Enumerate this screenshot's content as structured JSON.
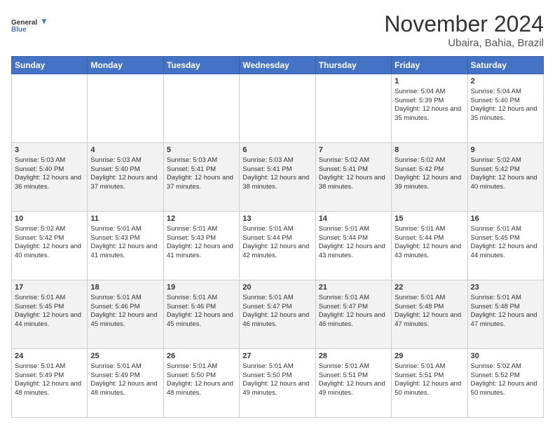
{
  "logo": {
    "line1": "General",
    "line2": "Blue"
  },
  "title": "November 2024",
  "location": "Ubaira, Bahia, Brazil",
  "days_of_week": [
    "Sunday",
    "Monday",
    "Tuesday",
    "Wednesday",
    "Thursday",
    "Friday",
    "Saturday"
  ],
  "weeks": [
    [
      {
        "day": "",
        "sunrise": "",
        "sunset": "",
        "daylight": ""
      },
      {
        "day": "",
        "sunrise": "",
        "sunset": "",
        "daylight": ""
      },
      {
        "day": "",
        "sunrise": "",
        "sunset": "",
        "daylight": ""
      },
      {
        "day": "",
        "sunrise": "",
        "sunset": "",
        "daylight": ""
      },
      {
        "day": "",
        "sunrise": "",
        "sunset": "",
        "daylight": ""
      },
      {
        "day": "1",
        "sunrise": "Sunrise: 5:04 AM",
        "sunset": "Sunset: 5:39 PM",
        "daylight": "Daylight: 12 hours and 35 minutes."
      },
      {
        "day": "2",
        "sunrise": "Sunrise: 5:04 AM",
        "sunset": "Sunset: 5:40 PM",
        "daylight": "Daylight: 12 hours and 35 minutes."
      }
    ],
    [
      {
        "day": "3",
        "sunrise": "Sunrise: 5:03 AM",
        "sunset": "Sunset: 5:40 PM",
        "daylight": "Daylight: 12 hours and 36 minutes."
      },
      {
        "day": "4",
        "sunrise": "Sunrise: 5:03 AM",
        "sunset": "Sunset: 5:40 PM",
        "daylight": "Daylight: 12 hours and 37 minutes."
      },
      {
        "day": "5",
        "sunrise": "Sunrise: 5:03 AM",
        "sunset": "Sunset: 5:41 PM",
        "daylight": "Daylight: 12 hours and 37 minutes."
      },
      {
        "day": "6",
        "sunrise": "Sunrise: 5:03 AM",
        "sunset": "Sunset: 5:41 PM",
        "daylight": "Daylight: 12 hours and 38 minutes."
      },
      {
        "day": "7",
        "sunrise": "Sunrise: 5:02 AM",
        "sunset": "Sunset: 5:41 PM",
        "daylight": "Daylight: 12 hours and 38 minutes."
      },
      {
        "day": "8",
        "sunrise": "Sunrise: 5:02 AM",
        "sunset": "Sunset: 5:42 PM",
        "daylight": "Daylight: 12 hours and 39 minutes."
      },
      {
        "day": "9",
        "sunrise": "Sunrise: 5:02 AM",
        "sunset": "Sunset: 5:42 PM",
        "daylight": "Daylight: 12 hours and 40 minutes."
      }
    ],
    [
      {
        "day": "10",
        "sunrise": "Sunrise: 5:02 AM",
        "sunset": "Sunset: 5:42 PM",
        "daylight": "Daylight: 12 hours and 40 minutes."
      },
      {
        "day": "11",
        "sunrise": "Sunrise: 5:01 AM",
        "sunset": "Sunset: 5:43 PM",
        "daylight": "Daylight: 12 hours and 41 minutes."
      },
      {
        "day": "12",
        "sunrise": "Sunrise: 5:01 AM",
        "sunset": "Sunset: 5:43 PM",
        "daylight": "Daylight: 12 hours and 41 minutes."
      },
      {
        "day": "13",
        "sunrise": "Sunrise: 5:01 AM",
        "sunset": "Sunset: 5:44 PM",
        "daylight": "Daylight: 12 hours and 42 minutes."
      },
      {
        "day": "14",
        "sunrise": "Sunrise: 5:01 AM",
        "sunset": "Sunset: 5:44 PM",
        "daylight": "Daylight: 12 hours and 43 minutes."
      },
      {
        "day": "15",
        "sunrise": "Sunrise: 5:01 AM",
        "sunset": "Sunset: 5:44 PM",
        "daylight": "Daylight: 12 hours and 43 minutes."
      },
      {
        "day": "16",
        "sunrise": "Sunrise: 5:01 AM",
        "sunset": "Sunset: 5:45 PM",
        "daylight": "Daylight: 12 hours and 44 minutes."
      }
    ],
    [
      {
        "day": "17",
        "sunrise": "Sunrise: 5:01 AM",
        "sunset": "Sunset: 5:45 PM",
        "daylight": "Daylight: 12 hours and 44 minutes."
      },
      {
        "day": "18",
        "sunrise": "Sunrise: 5:01 AM",
        "sunset": "Sunset: 5:46 PM",
        "daylight": "Daylight: 12 hours and 45 minutes."
      },
      {
        "day": "19",
        "sunrise": "Sunrise: 5:01 AM",
        "sunset": "Sunset: 5:46 PM",
        "daylight": "Daylight: 12 hours and 45 minutes."
      },
      {
        "day": "20",
        "sunrise": "Sunrise: 5:01 AM",
        "sunset": "Sunset: 5:47 PM",
        "daylight": "Daylight: 12 hours and 46 minutes."
      },
      {
        "day": "21",
        "sunrise": "Sunrise: 5:01 AM",
        "sunset": "Sunset: 5:47 PM",
        "daylight": "Daylight: 12 hours and 46 minutes."
      },
      {
        "day": "22",
        "sunrise": "Sunrise: 5:01 AM",
        "sunset": "Sunset: 5:48 PM",
        "daylight": "Daylight: 12 hours and 47 minutes."
      },
      {
        "day": "23",
        "sunrise": "Sunrise: 5:01 AM",
        "sunset": "Sunset: 5:48 PM",
        "daylight": "Daylight: 12 hours and 47 minutes."
      }
    ],
    [
      {
        "day": "24",
        "sunrise": "Sunrise: 5:01 AM",
        "sunset": "Sunset: 5:49 PM",
        "daylight": "Daylight: 12 hours and 48 minutes."
      },
      {
        "day": "25",
        "sunrise": "Sunrise: 5:01 AM",
        "sunset": "Sunset: 5:49 PM",
        "daylight": "Daylight: 12 hours and 48 minutes."
      },
      {
        "day": "26",
        "sunrise": "Sunrise: 5:01 AM",
        "sunset": "Sunset: 5:50 PM",
        "daylight": "Daylight: 12 hours and 48 minutes."
      },
      {
        "day": "27",
        "sunrise": "Sunrise: 5:01 AM",
        "sunset": "Sunset: 5:50 PM",
        "daylight": "Daylight: 12 hours and 49 minutes."
      },
      {
        "day": "28",
        "sunrise": "Sunrise: 5:01 AM",
        "sunset": "Sunset: 5:51 PM",
        "daylight": "Daylight: 12 hours and 49 minutes."
      },
      {
        "day": "29",
        "sunrise": "Sunrise: 5:01 AM",
        "sunset": "Sunset: 5:51 PM",
        "daylight": "Daylight: 12 hours and 50 minutes."
      },
      {
        "day": "30",
        "sunrise": "Sunrise: 5:02 AM",
        "sunset": "Sunset: 5:52 PM",
        "daylight": "Daylight: 12 hours and 50 minutes."
      }
    ]
  ]
}
